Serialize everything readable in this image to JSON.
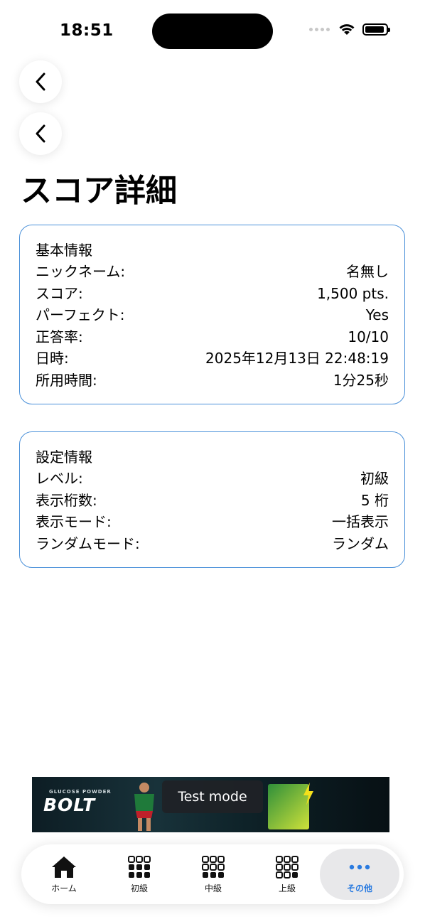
{
  "status_bar": {
    "time": "18:51"
  },
  "page": {
    "title": "スコア詳細"
  },
  "basic_info": {
    "title": "基本情報",
    "rows": [
      {
        "label": "ニックネーム:",
        "value": "名無し"
      },
      {
        "label": "スコア:",
        "value": "1,500 pts."
      },
      {
        "label": "パーフェクト:",
        "value": "Yes"
      },
      {
        "label": "正答率:",
        "value": "10/10"
      },
      {
        "label": "日時:",
        "value": "2025年12月13日 22:48:19"
      },
      {
        "label": "所用時間:",
        "value": "1分25秒"
      }
    ]
  },
  "settings_info": {
    "title": "設定情報",
    "rows": [
      {
        "label": "レベル:",
        "value": "初級"
      },
      {
        "label": "表示桁数:",
        "value": "5 桁"
      },
      {
        "label": "表示モード:",
        "value": "一括表示"
      },
      {
        "label": "ランダムモード:",
        "value": "ランダム"
      }
    ]
  },
  "ad": {
    "overlay": "Test mode",
    "brand": "BOLT",
    "brand_small": "GLUCOSE POWDER"
  },
  "tabbar": {
    "items": [
      {
        "label": "ホーム",
        "icon": "home-icon"
      },
      {
        "label": "初級",
        "icon": "grid-icon"
      },
      {
        "label": "中級",
        "icon": "grid-icon"
      },
      {
        "label": "上級",
        "icon": "grid-icon"
      },
      {
        "label": "その他",
        "icon": "more-icon",
        "active": true
      }
    ]
  },
  "colors": {
    "card_border": "#4a90d9",
    "active_tab": "#2a7be0"
  }
}
